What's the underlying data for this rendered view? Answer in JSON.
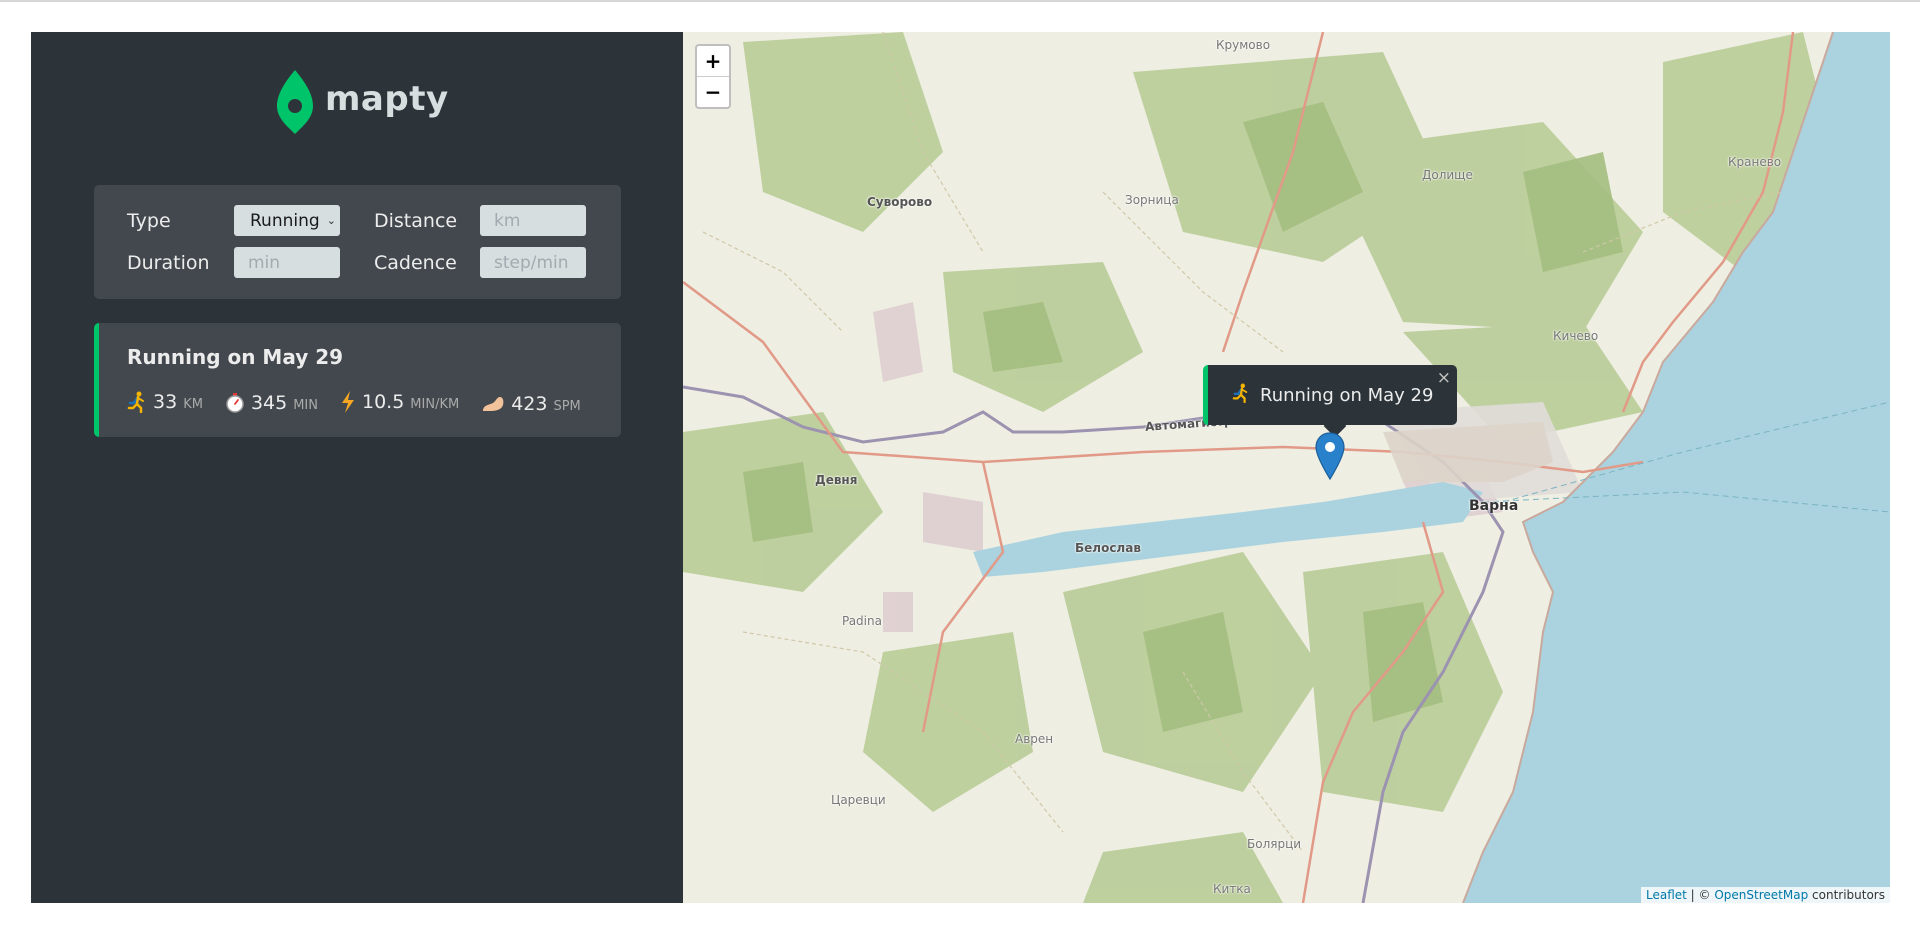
{
  "app": {
    "name": "mapty"
  },
  "form": {
    "type_label": "Type",
    "type_value": "Running",
    "distance_label": "Distance",
    "distance_placeholder": "km",
    "duration_label": "Duration",
    "duration_placeholder": "min",
    "cadence_label": "Cadence",
    "cadence_placeholder": "step/min"
  },
  "workouts": [
    {
      "title": "Running on May 29",
      "details": [
        {
          "icon": "runner-icon",
          "value": "33",
          "unit": "km"
        },
        {
          "icon": "stopwatch-icon",
          "value": "345",
          "unit": "min"
        },
        {
          "icon": "lightning-icon",
          "value": "10.5",
          "unit": "min/km"
        },
        {
          "icon": "foot-icon",
          "value": "423",
          "unit": "spm"
        }
      ]
    }
  ],
  "map": {
    "zoom_in": "+",
    "zoom_out": "−",
    "popup": {
      "icon": "runner-icon",
      "text": "Running on May 29",
      "close": "×"
    },
    "places": [
      {
        "id": "krumovo",
        "name": "Крумово"
      },
      {
        "id": "suvorovo",
        "name": "Суворово"
      },
      {
        "id": "zornitsa",
        "name": "Зорница"
      },
      {
        "id": "dolishte",
        "name": "Долище"
      },
      {
        "id": "kranevo",
        "name": "Кранево"
      },
      {
        "id": "kichevo",
        "name": "Кичево"
      },
      {
        "id": "devnya",
        "name": "Девня"
      },
      {
        "id": "avtomagistrala",
        "name": "Автомагистрала"
      },
      {
        "id": "varna",
        "name": "Варна"
      },
      {
        "id": "beloslav",
        "name": "Белослав"
      },
      {
        "id": "padina",
        "name": "Padina"
      },
      {
        "id": "avren",
        "name": "Аврен"
      },
      {
        "id": "tsarevtsi",
        "name": "Царевци"
      },
      {
        "id": "bolyartsi",
        "name": "Болярци"
      },
      {
        "id": "kitka",
        "name": "Китка"
      }
    ],
    "attribution": {
      "leaflet": "Leaflet",
      "separator": " | © ",
      "osm": "OpenStreetMap",
      "suffix": " contributors"
    }
  },
  "colors": {
    "brand": "#00c46a",
    "sidebar": "#2d3439",
    "panel": "#42484d",
    "sea": "#aad3df",
    "marker": "#2a81cb"
  }
}
